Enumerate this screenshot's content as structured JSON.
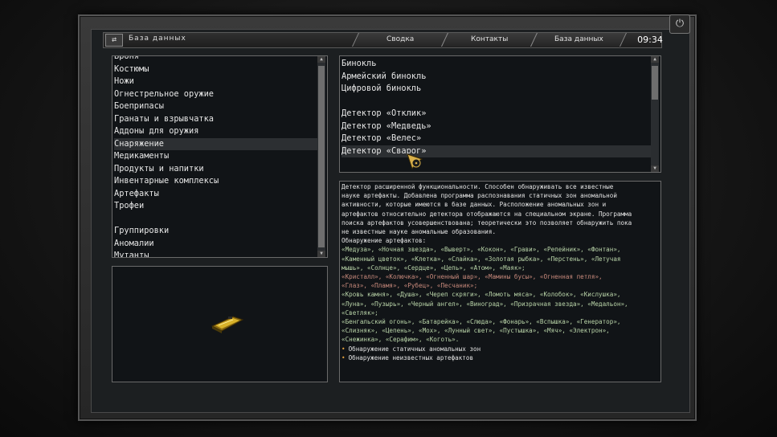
{
  "header": {
    "title": "База данных",
    "tabs": [
      "Сводка",
      "Контакты",
      "База данных"
    ],
    "clock": "09:34"
  },
  "categories": {
    "items": [
      "Броня",
      "Костюмы",
      "Ножи",
      "Огнестрельное оружие",
      "Боеприпасы",
      "Гранаты и взрывчатка",
      "Аддоны для оружия",
      "Снаряжение",
      "Медикаменты",
      "Продукты и напитки",
      "Инвентарные комплексы",
      "Артефакты",
      "Трофеи",
      "",
      "Группировки",
      "Аномалии",
      "Мутанты"
    ],
    "selected_index": 7
  },
  "items": {
    "entries": [
      "Бинокль",
      "Армейский бинокль",
      "Цифровой бинокль",
      "",
      "Детектор «Отклик»",
      "Детектор «Медведь»",
      "Детектор «Велес»",
      "Детектор «Сварог»"
    ],
    "selected_index": 7
  },
  "description": {
    "intro_lines": [
      "Детектор расширенной функциональности. Способен обнаруживать все известные",
      "науке артефакты. Добавлена программа распознавания статичных зон аномальной",
      "активности, которые имеются в базе данных. Расположение аномальных зон и",
      "артефактов относительно детектора отображаются на специальном экране. Программа",
      "поиска артефактов усовершенствована; теоретически это позволяет обнаружить пока",
      "не известные науке аномальные образования."
    ],
    "detect_title": "Обнаружение артефактов:",
    "green_lines_1": [
      "«Медуза», «Ночная звезда», «Выверт», «Кокон», «Грави», «Репейник», «Фонтан»,",
      "«Каменный цветок», «Клетка», «Слайка», «Золотая рыбка», «Перстень», «Летучая",
      "мышь», «Солнце», «Сердце», «Цепь», «Атом», «Маяк»;"
    ],
    "red_lines": [
      "«Кристалл», «Колючка», «Огненный шар», «Мамины бусы», «Огненная петля»,",
      "«Глаз», «Пламя», «Рубец», «Песчаник»;"
    ],
    "green_lines_2": [
      "«Кровь камня», «Душа», «Череп скряги», «Ломоть мяса», «Колобок», «Кислушка»,",
      "«Луна», «Пузырь», «Черный ангел», «Виноград», «Призрачная звезда», «Медальон»,",
      "«Светляк»;"
    ],
    "green_lines_3": [
      "«Бенгальский огонь», «Батарейка», «Слюда», «Фонарь», «Вспышка», «Генератор»,",
      "«Слизняк», «Цепень», «Мох», «Лунный свет», «Пустышка», «Мяч», «Электрон»,",
      "«Снежинка», «Серафим», «Коготь»."
    ],
    "features": [
      "Обнаружение статичных аномальных зон",
      "Обнаружение неизвестных артефактов"
    ],
    "bullet_glyph": "•"
  },
  "icons": {
    "database": "database-icon",
    "power": "power-icon",
    "item": "detector-item-icon",
    "cursor": "radiation-cursor-icon"
  },
  "colors": {
    "accent_bullet": "#e8a33d",
    "green_text": "#b9d4a8",
    "red_text": "#c98a7c"
  }
}
